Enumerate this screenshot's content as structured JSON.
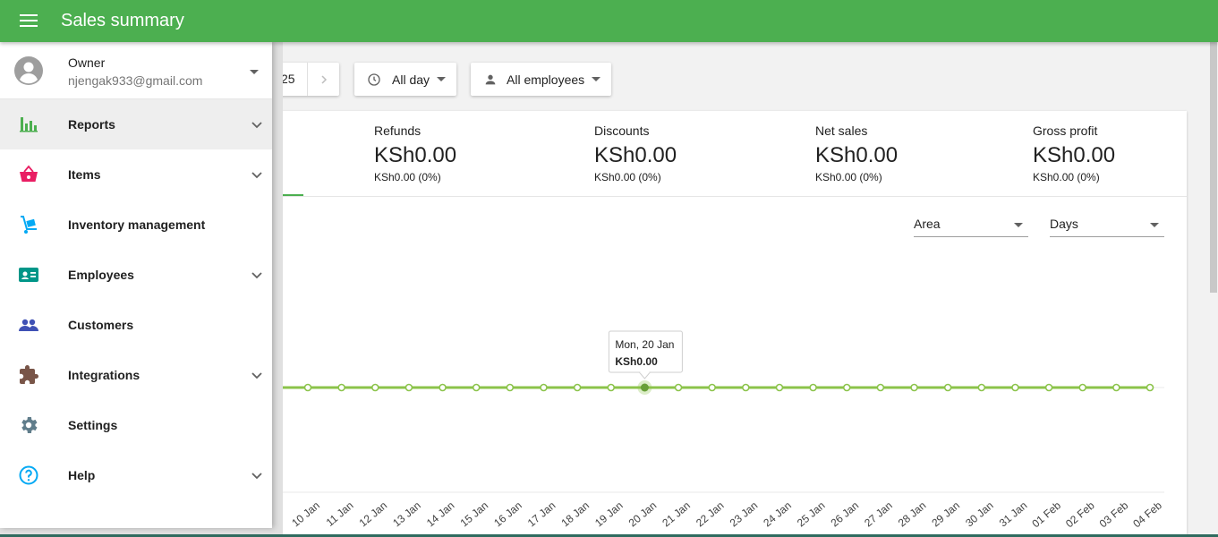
{
  "appbar": {
    "title": "Sales summary",
    "menu_icon": "menu-icon"
  },
  "filters": {
    "date_partial": "25",
    "time_label": "All day",
    "employees_label": "All employees"
  },
  "metrics": [
    {
      "label": "Refunds",
      "value": "KSh0.00",
      "change": "KSh0.00 (0%)"
    },
    {
      "label": "Discounts",
      "value": "KSh0.00",
      "change": "KSh0.00 (0%)"
    },
    {
      "label": "Net sales",
      "value": "KSh0.00",
      "change": "KSh0.00 (0%)"
    },
    {
      "label": "Gross profit",
      "value": "KSh0.00",
      "change": "KSh0.00 (0%)"
    }
  ],
  "chart_controls": {
    "chart_type": "Area",
    "period": "Days"
  },
  "chart_data": {
    "type": "area",
    "x": [
      "10 Jan",
      "11 Jan",
      "12 Jan",
      "13 Jan",
      "14 Jan",
      "15 Jan",
      "16 Jan",
      "17 Jan",
      "18 Jan",
      "19 Jan",
      "20 Jan",
      "21 Jan",
      "22 Jan",
      "23 Jan",
      "24 Jan",
      "25 Jan",
      "26 Jan",
      "27 Jan",
      "28 Jan",
      "29 Jan",
      "30 Jan",
      "31 Jan",
      "01 Feb",
      "02 Feb",
      "03 Feb",
      "04 Feb"
    ],
    "series": [
      {
        "values": [
          0,
          0,
          0,
          0,
          0,
          0,
          0,
          0,
          0,
          0,
          0,
          0,
          0,
          0,
          0,
          0,
          0,
          0,
          0,
          0,
          0,
          0,
          0,
          0,
          0,
          0
        ]
      }
    ],
    "highlight_index": 10,
    "tooltip": {
      "date": "Mon, 20 Jan",
      "value": "KSh0.00"
    },
    "line_color": "#8bc34a",
    "grid": true
  },
  "drawer": {
    "account": {
      "name": "Owner",
      "email": "njengak933@gmail.com"
    },
    "items": [
      {
        "label": "Reports",
        "icon": "bar-chart-icon",
        "expandable": true,
        "active": true
      },
      {
        "label": "Items",
        "icon": "basket-icon",
        "expandable": true,
        "active": false
      },
      {
        "label": "Inventory management",
        "icon": "hand-truck-icon",
        "expandable": false,
        "active": false
      },
      {
        "label": "Employees",
        "icon": "id-card-icon",
        "expandable": true,
        "active": false
      },
      {
        "label": "Customers",
        "icon": "people-icon",
        "expandable": false,
        "active": false
      },
      {
        "label": "Integrations",
        "icon": "puzzle-icon",
        "expandable": true,
        "active": false
      },
      {
        "label": "Settings",
        "icon": "gear-icon",
        "expandable": false,
        "active": false
      },
      {
        "label": "Help",
        "icon": "help-icon",
        "expandable": true,
        "active": false
      }
    ]
  },
  "colors": {
    "primary": "#4caf50",
    "reports_icon": "#4caf50",
    "items_icon": "#e91e63",
    "inventory_icon": "#03a9f4",
    "employees_icon": "#009688",
    "customers_icon": "#3f51b5",
    "integrations_icon": "#795548",
    "settings_icon": "#607d8b",
    "help_icon": "#03a9f4"
  }
}
